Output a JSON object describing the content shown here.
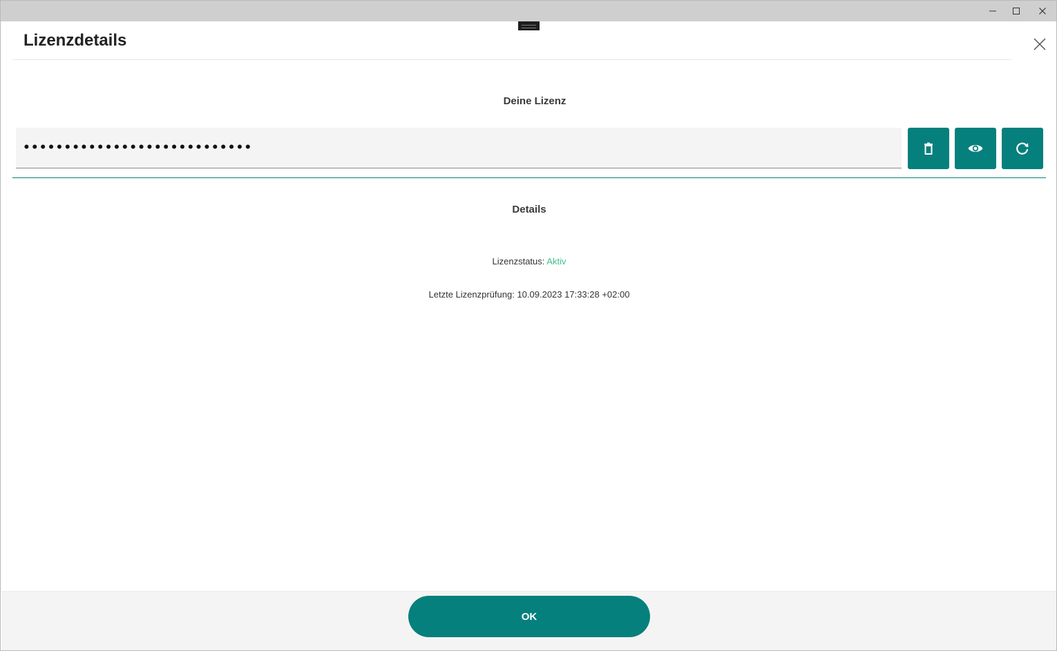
{
  "dialog": {
    "title": "Lizenzdetails",
    "close_icon": "close-icon"
  },
  "window_controls": {
    "minimize_icon": "minimize-icon",
    "maximize_icon": "maximize-icon",
    "close_icon": "close-icon"
  },
  "license": {
    "section_title": "Deine Lizenz",
    "masked_value": "••••••••••••••••••••••••••••",
    "actions": [
      {
        "name": "delete",
        "icon": "trash-icon"
      },
      {
        "name": "show",
        "icon": "eye-icon"
      },
      {
        "name": "refresh",
        "icon": "refresh-icon"
      }
    ]
  },
  "details": {
    "section_title": "Details",
    "status_label": "Lizenzstatus:",
    "status_value": "Aktiv",
    "last_check_label": "Letzte Lizenzprüfung:",
    "last_check_value": "10.09.2023 17:33:28 +02:00"
  },
  "footer": {
    "ok_label": "OK"
  },
  "colors": {
    "accent": "#06807d",
    "status_active": "#3fbf8a",
    "footer_bg": "#f4f4f4",
    "titlebar_bg": "#cfcfcf"
  }
}
